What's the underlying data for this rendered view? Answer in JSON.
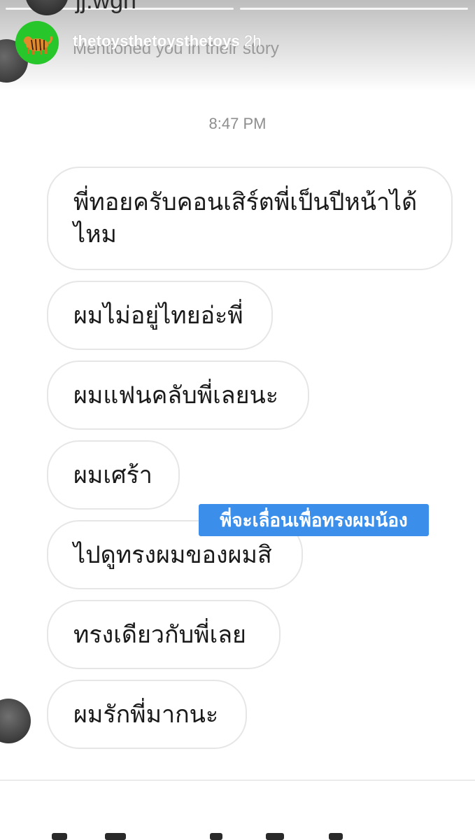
{
  "story": {
    "behind_username": "jj.wgn",
    "username": "thetoysthetoysthetoys",
    "time_ago": "2h",
    "mention_text": "Mentioned you in their story"
  },
  "chat": {
    "timestamp": "8:47 PM",
    "messages": [
      "พี่ทอยครับคอนเสิร์ตพี่เป็นปีหน้าได้ไหม",
      "ผมไม่อยู่ไทยอ่ะพี่",
      "ผมแฟนคลับพี่เลยนะ",
      "ผมเศร้า",
      "ไปดูทรงผมของผมสิ",
      "ทรงเดียวกับพี่เลย",
      "ผมรักพี่มากนะ"
    ]
  },
  "sticker": {
    "text": "พี่จะเลื่อนเพื่อทรงผมน้อง",
    "color": "#3b8eea"
  },
  "icons": {
    "story_avatar": "tiger-avatar-icon"
  }
}
